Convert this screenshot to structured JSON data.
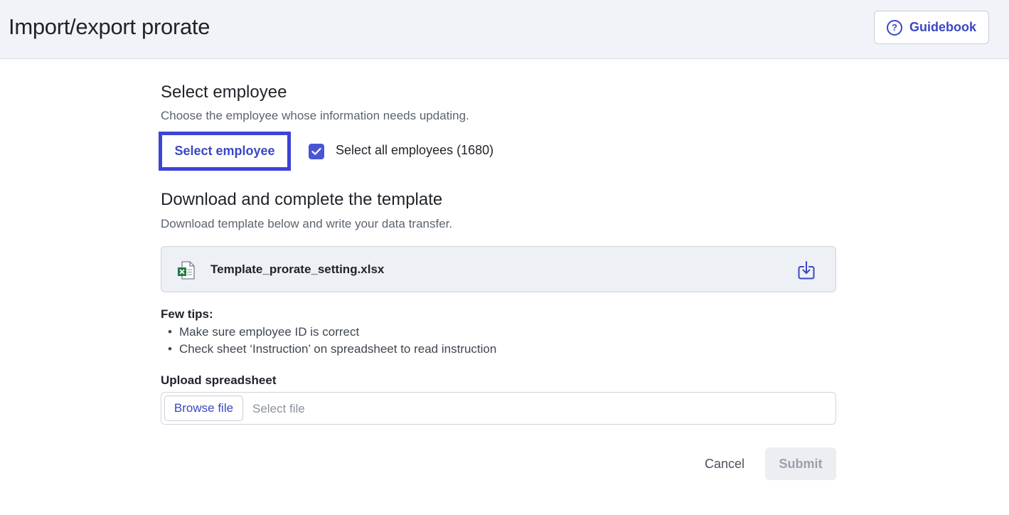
{
  "header": {
    "title": "Import/export prorate",
    "guidebook_label": "Guidebook",
    "guidebook_icon": "help-circle-icon"
  },
  "select_employee": {
    "title": "Select employee",
    "subtitle": "Choose the employee whose information needs updating.",
    "button_label": "Select employee",
    "select_all_checked": true,
    "select_all_label": "Select all employees (1680)"
  },
  "template": {
    "title": "Download and complete the template",
    "subtitle": "Download template below and write your data transfer.",
    "file_name": "Template_prorate_setting.xlsx",
    "file_icon": "excel-file-icon",
    "download_icon": "download-icon"
  },
  "tips": {
    "title": "Few tips:",
    "items": [
      "Make sure employee ID is correct",
      "Check sheet ‘Instruction’ on spreadsheet to read instruction"
    ]
  },
  "upload": {
    "label": "Upload spreadsheet",
    "browse_label": "Browse file",
    "placeholder": "Select file"
  },
  "actions": {
    "cancel_label": "Cancel",
    "submit_label": "Submit"
  },
  "colors": {
    "accent": "#3a47c4",
    "highlight_border": "#3c43d6",
    "header_bg": "#f0f3f8",
    "checkbox": "#4a54d6"
  }
}
